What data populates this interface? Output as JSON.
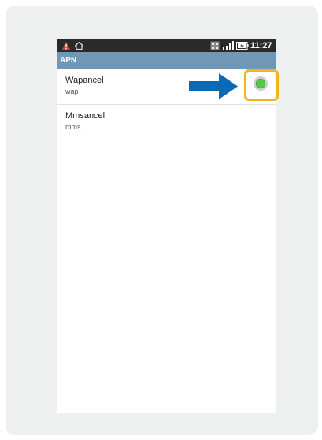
{
  "status_bar": {
    "time": "11:27",
    "icons": [
      "warning-icon",
      "home-icon",
      "data-icon",
      "signal-icon",
      "battery-icon"
    ]
  },
  "title_bar": {
    "title": "APN"
  },
  "apn_list": [
    {
      "name": "Wapancel",
      "type": "wap",
      "selected": true
    },
    {
      "name": "Mmsancel",
      "type": "mms",
      "selected": false
    }
  ],
  "annotation": {
    "arrow_color": "#0a6ab5",
    "highlight_color": "#f4b21b"
  },
  "colors": {
    "title_bar": "#6f97b8",
    "radio_selected": "#4fbf43"
  }
}
